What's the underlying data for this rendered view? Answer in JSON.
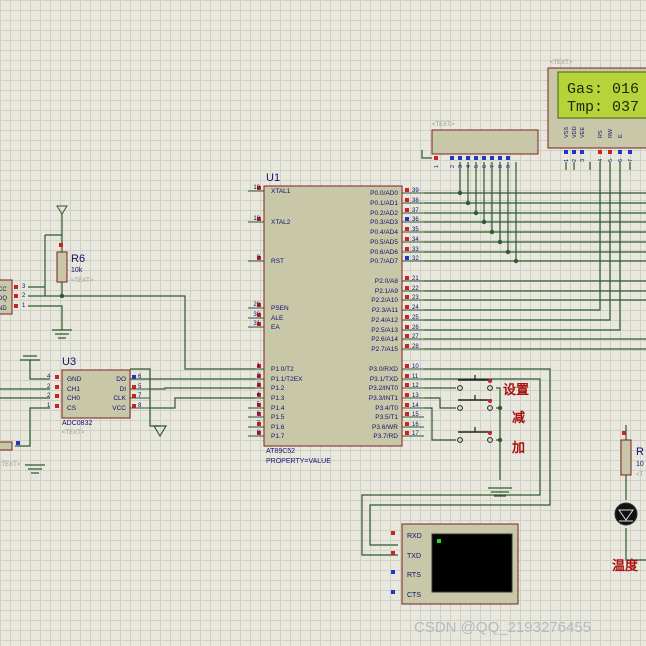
{
  "mcu": {
    "ref": "U1",
    "part": "AT89C52",
    "property": "PROPERTY=VALUE",
    "left_pins": [
      {
        "num": "19",
        "name": "XTAL1"
      },
      {
        "num": "18",
        "name": "XTAL2"
      },
      {
        "num": "9",
        "name": "RST"
      },
      {
        "num": "29",
        "name": "PSEN"
      },
      {
        "num": "30",
        "name": "ALE"
      },
      {
        "num": "31",
        "name": "EA"
      },
      {
        "num": "1",
        "name": "P1.0/T2"
      },
      {
        "num": "2",
        "name": "P1.1/T2EX"
      },
      {
        "num": "3",
        "name": "P1.2"
      },
      {
        "num": "4",
        "name": "P1.3"
      },
      {
        "num": "5",
        "name": "P1.4"
      },
      {
        "num": "6",
        "name": "P1.5"
      },
      {
        "num": "7",
        "name": "P1.6"
      },
      {
        "num": "8",
        "name": "P1.7"
      }
    ],
    "right_pins": [
      {
        "num": "39",
        "name": "P0.0/AD0"
      },
      {
        "num": "38",
        "name": "P0.1/AD1"
      },
      {
        "num": "37",
        "name": "P0.2/AD2"
      },
      {
        "num": "36",
        "name": "P0.3/AD3"
      },
      {
        "num": "35",
        "name": "P0.4/AD4"
      },
      {
        "num": "34",
        "name": "P0.5/AD5"
      },
      {
        "num": "33",
        "name": "P0.6/AD6"
      },
      {
        "num": "32",
        "name": "P0.7/AD7"
      },
      {
        "num": "21",
        "name": "P2.0/A8"
      },
      {
        "num": "22",
        "name": "P2.1/A9"
      },
      {
        "num": "23",
        "name": "P2.2/A10"
      },
      {
        "num": "24",
        "name": "P2.3/A11"
      },
      {
        "num": "25",
        "name": "P2.4/A12"
      },
      {
        "num": "26",
        "name": "P2.5/A13"
      },
      {
        "num": "27",
        "name": "P2.6/A14"
      },
      {
        "num": "28",
        "name": "P2.7/A15"
      },
      {
        "num": "10",
        "name": "P3.0/RXD"
      },
      {
        "num": "11",
        "name": "P3.1/TXD"
      },
      {
        "num": "12",
        "name": "P3.2/INT0"
      },
      {
        "num": "13",
        "name": "P3.3/INT1"
      },
      {
        "num": "14",
        "name": "P3.4/T0"
      },
      {
        "num": "15",
        "name": "P3.5/T1"
      },
      {
        "num": "16",
        "name": "P3.6/WR"
      },
      {
        "num": "17",
        "name": "P3.7/RD"
      }
    ]
  },
  "adc": {
    "ref": "U3",
    "part": "ADC0832",
    "text_tag": "<TEXT>",
    "left_pins": [
      {
        "num": "4",
        "name": "GND"
      },
      {
        "num": "2",
        "name": "CH1"
      },
      {
        "num": "2",
        "name": "CH0"
      },
      {
        "num": "1",
        "name": "CS"
      }
    ],
    "right_pins": [
      {
        "num": "6",
        "name": "DO"
      },
      {
        "num": "5",
        "name": "DI"
      },
      {
        "num": "7",
        "name": "CLK"
      },
      {
        "num": "8",
        "name": "VCC"
      }
    ]
  },
  "resistor_r6": {
    "ref": "R6",
    "value": "10k",
    "text_tag": "<TEXT>"
  },
  "left_sensor": {
    "pins": [
      {
        "num": "3",
        "name": "CC"
      },
      {
        "num": "2",
        "name": "DQ"
      },
      {
        "num": "1",
        "name": "ND"
      }
    ]
  },
  "lcd": {
    "text_tag": "<TEXT>",
    "line1": "Gas: 016",
    "line2": "Tmp: 037",
    "pin_labels": [
      "VSS",
      "VDD",
      "VEE",
      "RS",
      "RW",
      "E"
    ],
    "pin_numbers": [
      "1",
      "2",
      "3",
      "4",
      "5",
      "6",
      "7"
    ]
  },
  "resnet": {
    "text_tag": "<TEXT>",
    "pin_numbers": [
      "1",
      "2",
      "3",
      "4",
      "5",
      "6",
      "7",
      "8",
      "9"
    ]
  },
  "buttons": {
    "labels": [
      "设置",
      "减",
      "加"
    ]
  },
  "terminal": {
    "pins": [
      "RXD",
      "TXD",
      "RTS",
      "CTS"
    ]
  },
  "right_resistor": {
    "ref": "R",
    "value": "10",
    "text_tag": "<T"
  },
  "led_label": "温度",
  "watermark": "CSDN @QQ_2193276455",
  "colors": {
    "wire": "#2e5a2e",
    "body": "#c8c8a8",
    "body_stroke": "#7a2020",
    "pin_red": "#cc2222",
    "pin_blue": "#2233cc",
    "lcd_bg": "#b6d33a",
    "text": "#101070"
  }
}
